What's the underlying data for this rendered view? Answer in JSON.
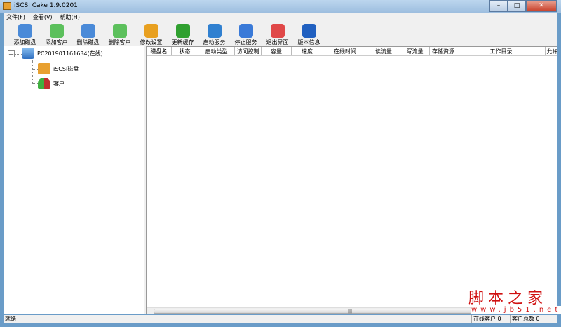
{
  "window": {
    "title": "iSCSI Cake 1.9.0201",
    "min": "–",
    "max": "□",
    "close": "✕"
  },
  "menu": [
    {
      "label": "文件(F)"
    },
    {
      "label": "查看(V)"
    },
    {
      "label": "帮助(H)"
    }
  ],
  "toolbar": [
    {
      "label": "添加磁盘",
      "icon": "add-disk-icon",
      "color": "#4a8ad8"
    },
    {
      "label": "添加客户",
      "icon": "add-client-icon",
      "color": "#5cc05c"
    },
    {
      "label": "删除磁盘",
      "icon": "delete-disk-icon",
      "color": "#4a8ad8"
    },
    {
      "label": "删除客户",
      "icon": "delete-client-icon",
      "color": "#5cc05c"
    },
    {
      "label": "修改设置",
      "icon": "wrench-icon",
      "color": "#e8a020"
    },
    {
      "label": "更新缓存",
      "icon": "refresh-icon",
      "color": "#30a030"
    },
    {
      "label": "启动服务",
      "icon": "play-icon",
      "color": "#3080d0"
    },
    {
      "label": "停止服务",
      "icon": "stop-x-icon",
      "color": "#3a7ad8"
    },
    {
      "label": "退出界面",
      "icon": "exit-icon",
      "color": "#e04848"
    },
    {
      "label": "版本信息",
      "icon": "info-icon",
      "color": "#2060c0"
    }
  ],
  "tree": {
    "expander": "—",
    "root": "PC201901161634(在线)",
    "children": [
      "iSCSI磁盘",
      "客户"
    ]
  },
  "table": {
    "columns": [
      "磁盘名",
      "状态",
      "启动类型",
      "访问控制",
      "容量",
      "速度",
      "在线时间",
      "读流量",
      "写流量",
      "存储资源",
      "工作目录",
      "允许"
    ],
    "rows": []
  },
  "scroll_grip": "|||",
  "status": {
    "left": "就绪",
    "online": "在线客户 0",
    "total": "客户总数 0"
  },
  "watermark": {
    "cn": "脚本之家",
    "url": "www.jb51.net"
  }
}
